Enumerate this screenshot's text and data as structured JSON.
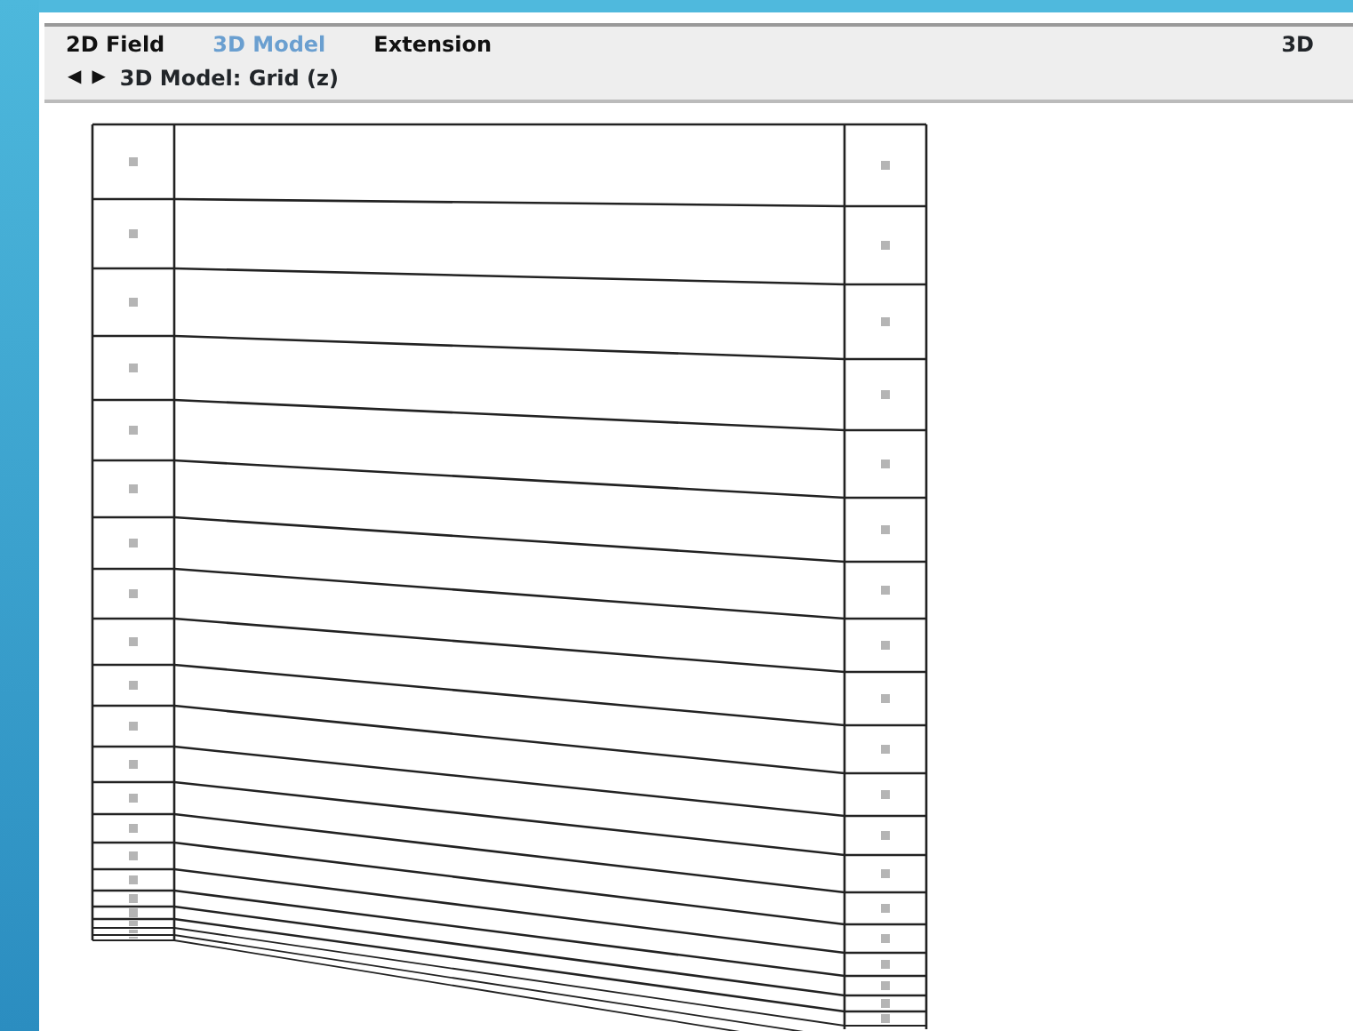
{
  "tabs": [
    {
      "label": "2D Field",
      "selected": false
    },
    {
      "label": "3D Model",
      "selected": true
    },
    {
      "label": "Extension",
      "selected": false
    }
  ],
  "mode_label": "3D",
  "nav": {
    "back": "◀",
    "forward": "▶",
    "breadcrumb": "3D Model: Grid (z)"
  }
}
